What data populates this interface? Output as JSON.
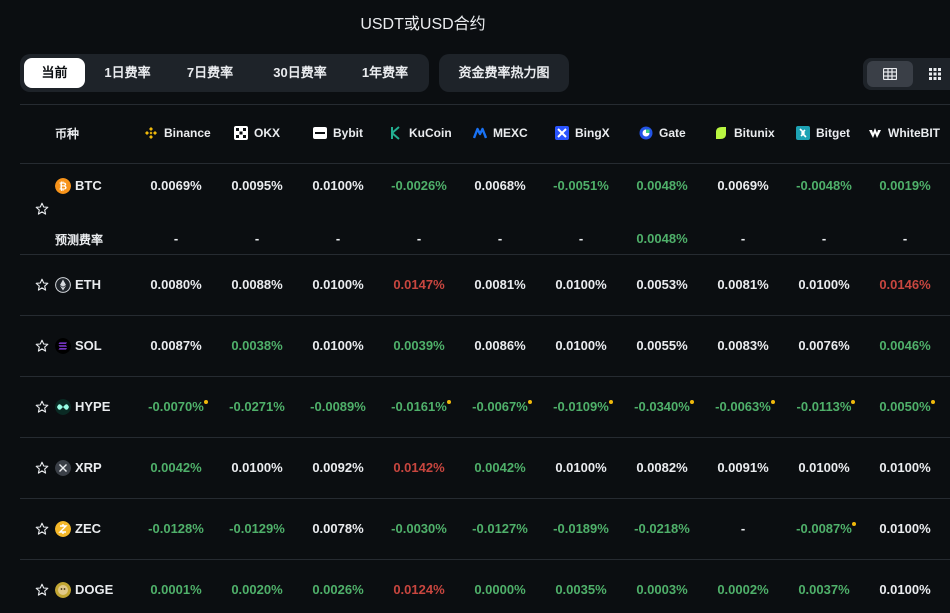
{
  "title": "USDT或USD合约",
  "tabs": [
    "当前",
    "1日费率",
    "7日费率",
    "30日费率",
    "1年费率"
  ],
  "active_tab": 0,
  "heatmap_label": "资金费率热力图",
  "view_modes": [
    "table-icon",
    "grid-icon"
  ],
  "header": {
    "coin_label": "币种",
    "exchanges": [
      {
        "name": "Binance",
        "icon": "binance-icon",
        "color": "#f0b90b"
      },
      {
        "name": "OKX",
        "icon": "okx-icon",
        "color": "#ffffff"
      },
      {
        "name": "Bybit",
        "icon": "bybit-icon",
        "color": "#ffffff"
      },
      {
        "name": "KuCoin",
        "icon": "kucoin-icon",
        "color": "#23af91"
      },
      {
        "name": "MEXC",
        "icon": "mexc-icon",
        "color": "#1972f5"
      },
      {
        "name": "BingX",
        "icon": "bingx-icon",
        "color": "#2a54ff"
      },
      {
        "name": "Gate",
        "icon": "gate-icon",
        "color": "#2354e6"
      },
      {
        "name": "Bitunix",
        "icon": "bitunix-icon",
        "color": "#b9f641"
      },
      {
        "name": "Bitget",
        "icon": "bitget-icon",
        "color": "#1da2b4"
      },
      {
        "name": "WhiteBIT",
        "icon": "whitebit-icon",
        "color": "#ffffff"
      }
    ]
  },
  "rows": [
    {
      "coin": "BTC",
      "icon": "btc-icon",
      "icon_color": "#f7931a",
      "rates": [
        {
          "v": "0.0069%",
          "c": "w"
        },
        {
          "v": "0.0095%",
          "c": "w"
        },
        {
          "v": "0.0100%",
          "c": "w"
        },
        {
          "v": "-0.0026%",
          "c": "g"
        },
        {
          "v": "0.0068%",
          "c": "w"
        },
        {
          "v": "-0.0051%",
          "c": "g"
        },
        {
          "v": "0.0048%",
          "c": "g"
        },
        {
          "v": "0.0069%",
          "c": "w"
        },
        {
          "v": "-0.0048%",
          "c": "g"
        },
        {
          "v": "0.0019%",
          "c": "g"
        }
      ]
    },
    {
      "coin": "ETH",
      "icon": "eth-icon",
      "icon_color": "#d6d9de",
      "rates": [
        {
          "v": "0.0080%",
          "c": "w"
        },
        {
          "v": "0.0088%",
          "c": "w"
        },
        {
          "v": "0.0100%",
          "c": "w"
        },
        {
          "v": "0.0147%",
          "c": "r"
        },
        {
          "v": "0.0081%",
          "c": "w"
        },
        {
          "v": "0.0100%",
          "c": "w"
        },
        {
          "v": "0.0053%",
          "c": "w"
        },
        {
          "v": "0.0081%",
          "c": "w"
        },
        {
          "v": "0.0100%",
          "c": "w"
        },
        {
          "v": "0.0146%",
          "c": "r"
        }
      ]
    },
    {
      "coin": "SOL",
      "icon": "sol-icon",
      "icon_color": "#9945ff",
      "rates": [
        {
          "v": "0.0087%",
          "c": "w"
        },
        {
          "v": "0.0038%",
          "c": "g"
        },
        {
          "v": "0.0100%",
          "c": "w"
        },
        {
          "v": "0.0039%",
          "c": "g"
        },
        {
          "v": "0.0086%",
          "c": "w"
        },
        {
          "v": "0.0100%",
          "c": "w"
        },
        {
          "v": "0.0055%",
          "c": "w"
        },
        {
          "v": "0.0083%",
          "c": "w"
        },
        {
          "v": "0.0076%",
          "c": "w"
        },
        {
          "v": "0.0046%",
          "c": "g"
        }
      ]
    },
    {
      "coin": "HYPE",
      "icon": "hype-icon",
      "icon_color": "#97fce4",
      "rates": [
        {
          "v": "-0.0070%",
          "c": "g",
          "mark": true
        },
        {
          "v": "-0.0271%",
          "c": "g"
        },
        {
          "v": "-0.0089%",
          "c": "g"
        },
        {
          "v": "-0.0161%",
          "c": "g",
          "mark": true
        },
        {
          "v": "-0.0067%",
          "c": "g",
          "mark": true
        },
        {
          "v": "-0.0109%",
          "c": "g",
          "mark": true
        },
        {
          "v": "-0.0340%",
          "c": "g",
          "mark": true
        },
        {
          "v": "-0.0063%",
          "c": "g",
          "mark": true
        },
        {
          "v": "-0.0113%",
          "c": "g",
          "mark": true
        },
        {
          "v": "0.0050%",
          "c": "g",
          "mark": true
        }
      ]
    },
    {
      "coin": "XRP",
      "icon": "xrp-icon",
      "icon_color": "#3a3f47",
      "rates": [
        {
          "v": "0.0042%",
          "c": "g"
        },
        {
          "v": "0.0100%",
          "c": "w"
        },
        {
          "v": "0.0092%",
          "c": "w"
        },
        {
          "v": "0.0142%",
          "c": "r"
        },
        {
          "v": "0.0042%",
          "c": "g"
        },
        {
          "v": "0.0100%",
          "c": "w"
        },
        {
          "v": "0.0082%",
          "c": "w"
        },
        {
          "v": "0.0091%",
          "c": "w"
        },
        {
          "v": "0.0100%",
          "c": "w"
        },
        {
          "v": "0.0100%",
          "c": "w"
        }
      ]
    },
    {
      "coin": "ZEC",
      "icon": "zec-icon",
      "icon_color": "#f4b728",
      "rates": [
        {
          "v": "-0.0128%",
          "c": "g"
        },
        {
          "v": "-0.0129%",
          "c": "g"
        },
        {
          "v": "0.0078%",
          "c": "w"
        },
        {
          "v": "-0.0030%",
          "c": "g"
        },
        {
          "v": "-0.0127%",
          "c": "g"
        },
        {
          "v": "-0.0189%",
          "c": "g"
        },
        {
          "v": "-0.0218%",
          "c": "g"
        },
        {
          "v": "-",
          "c": "w"
        },
        {
          "v": "-0.0087%",
          "c": "g",
          "mark": true
        },
        {
          "v": "0.0100%",
          "c": "w"
        }
      ]
    },
    {
      "coin": "DOGE",
      "icon": "doge-icon",
      "icon_color": "#c2a633",
      "rates": [
        {
          "v": "0.0001%",
          "c": "g"
        },
        {
          "v": "0.0020%",
          "c": "g"
        },
        {
          "v": "0.0026%",
          "c": "g"
        },
        {
          "v": "0.0124%",
          "c": "r"
        },
        {
          "v": "0.0000%",
          "c": "g"
        },
        {
          "v": "0.0035%",
          "c": "g"
        },
        {
          "v": "0.0003%",
          "c": "g"
        },
        {
          "v": "0.0002%",
          "c": "g"
        },
        {
          "v": "0.0037%",
          "c": "g"
        },
        {
          "v": "0.0100%",
          "c": "w"
        }
      ]
    }
  ],
  "predicted": {
    "label": "预测费率",
    "rates": [
      {
        "v": "-",
        "c": "w"
      },
      {
        "v": "-",
        "c": "w"
      },
      {
        "v": "-",
        "c": "w"
      },
      {
        "v": "-",
        "c": "w"
      },
      {
        "v": "-",
        "c": "w"
      },
      {
        "v": "-",
        "c": "w"
      },
      {
        "v": "0.0048%",
        "c": "g"
      },
      {
        "v": "-",
        "c": "w"
      },
      {
        "v": "-",
        "c": "w"
      },
      {
        "v": "-",
        "c": "w"
      }
    ]
  }
}
